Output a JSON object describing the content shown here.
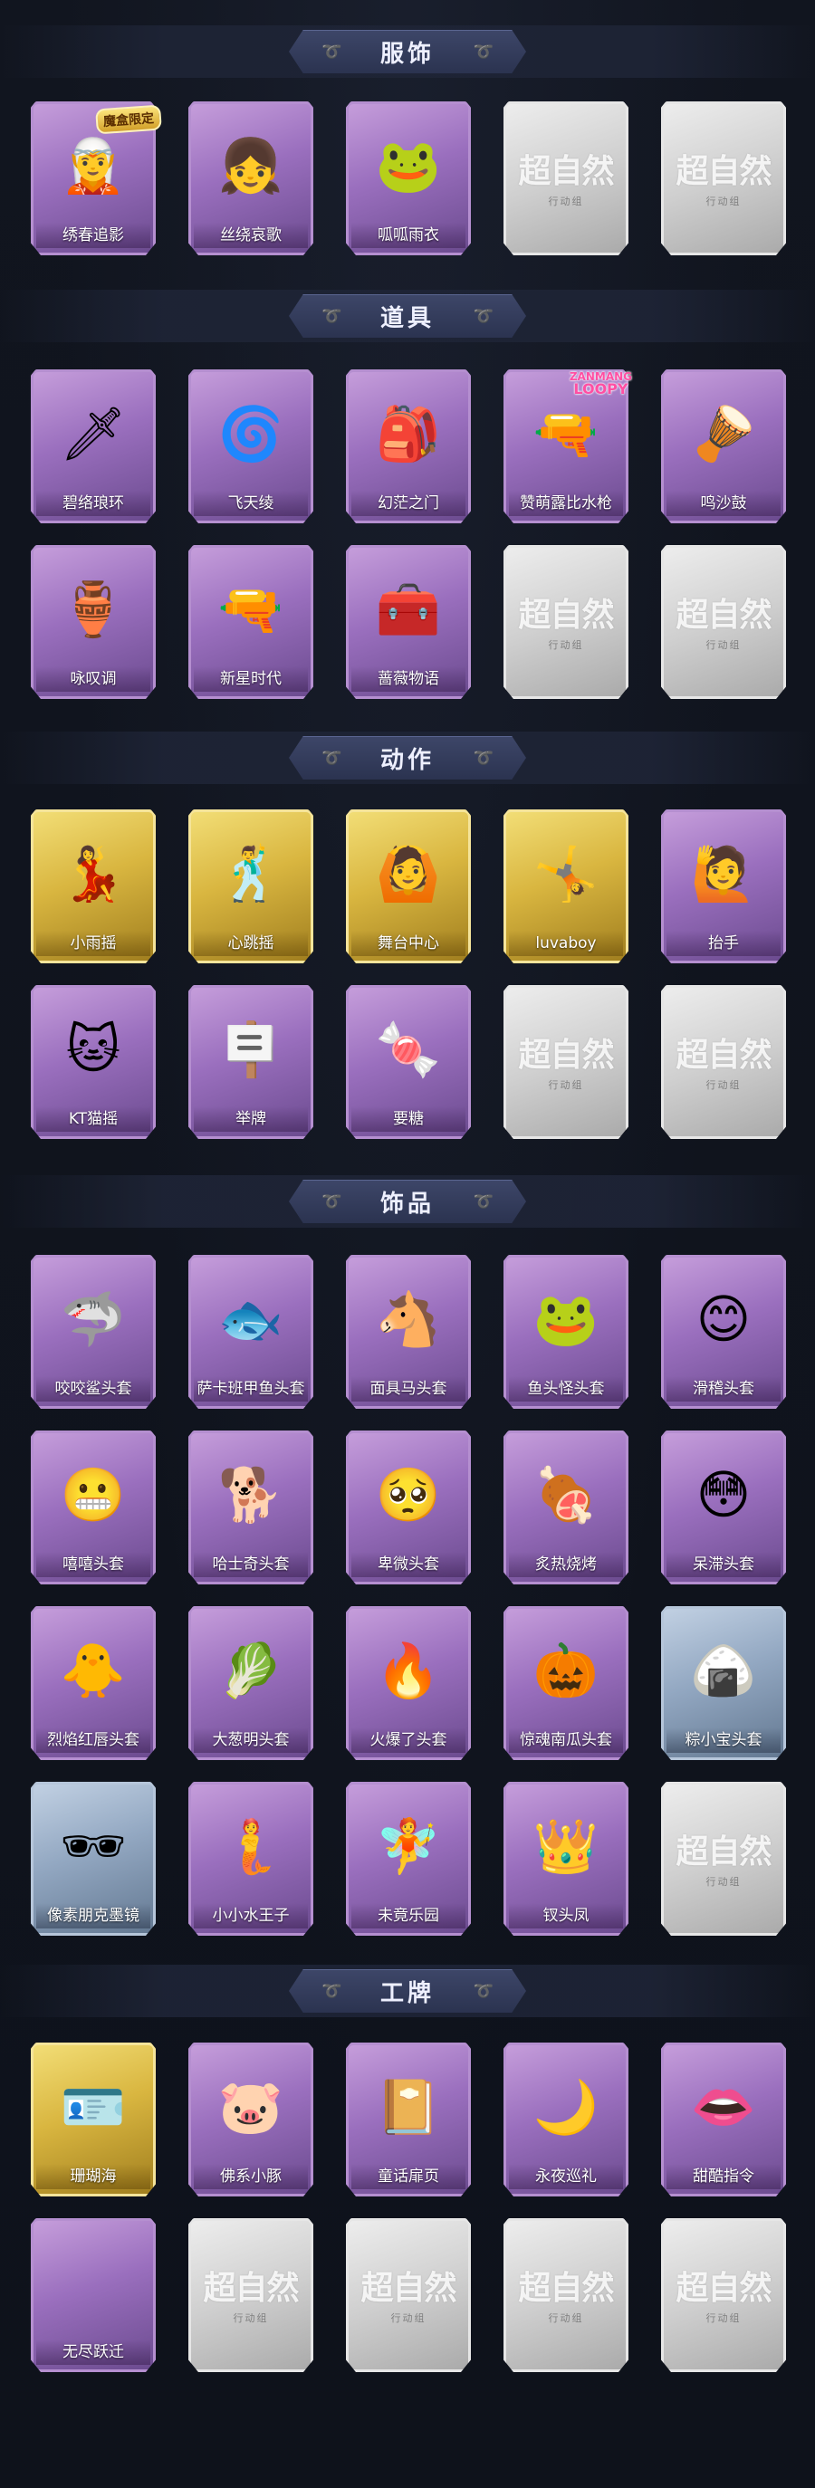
{
  "sections": [
    {
      "title": "服饰",
      "items": [
        {
          "label": "绣春追影",
          "tier": "purple",
          "icon": "long-hair-costume-character-icon",
          "glyph": "🧝",
          "badge": "魔盒限定"
        },
        {
          "label": "丝绕哀歌",
          "tier": "purple",
          "icon": "pink-hair-doll-character-icon",
          "glyph": "👧"
        },
        {
          "label": "呱呱雨衣",
          "tier": "purple",
          "icon": "frog-hood-raincoat-character-icon",
          "glyph": "🐸"
        },
        {
          "label": "",
          "tier": "empty",
          "icon": "empty-slot-icon"
        },
        {
          "label": "",
          "tier": "empty",
          "icon": "empty-slot-icon"
        }
      ]
    },
    {
      "title": "道具",
      "items": [
        {
          "label": "碧络琅环",
          "tier": "purple",
          "icon": "jade-sword-icon",
          "glyph": "🗡"
        },
        {
          "label": "飞天绫",
          "tier": "purple",
          "icon": "ribbon-whip-icon",
          "glyph": "🌀"
        },
        {
          "label": "幻茫之门",
          "tier": "purple",
          "icon": "pet-bag-door-icon",
          "glyph": "🎒"
        },
        {
          "label": "赞萌露比水枪",
          "tier": "purple",
          "icon": "water-gun-icon",
          "glyph": "🔫",
          "brand_top": "ZANMANG",
          "brand_bottom": "LOOPY"
        },
        {
          "label": "鸣沙鼓",
          "tier": "purple",
          "icon": "sand-drum-icon",
          "glyph": "🪘"
        },
        {
          "label": "咏叹调",
          "tier": "purple",
          "icon": "music-box-icon",
          "glyph": "🏺"
        },
        {
          "label": "新星时代",
          "tier": "purple",
          "icon": "golden-revolver-icon",
          "glyph": "🔫"
        },
        {
          "label": "蔷薇物语",
          "tier": "purple",
          "icon": "red-medical-kit-icon",
          "glyph": "🧰"
        },
        {
          "label": "",
          "tier": "empty",
          "icon": "empty-slot-icon"
        },
        {
          "label": "",
          "tier": "empty",
          "icon": "empty-slot-icon"
        }
      ]
    },
    {
      "title": "动作",
      "items": [
        {
          "label": "小雨摇",
          "tier": "gold",
          "icon": "dance-pose-icon",
          "glyph": "💃"
        },
        {
          "label": "心跳摇",
          "tier": "gold",
          "icon": "heart-dance-pose-icon",
          "glyph": "🕺"
        },
        {
          "label": "舞台中心",
          "tier": "gold",
          "icon": "stage-pose-icon",
          "glyph": "🙆"
        },
        {
          "label": "luvaboy",
          "tier": "gold",
          "icon": "luvaboy-pose-icon",
          "glyph": "🤸"
        },
        {
          "label": "抬手",
          "tier": "purple",
          "icon": "raise-hand-pose-icon",
          "glyph": "🙋"
        },
        {
          "label": "KT猫摇",
          "tier": "purple",
          "icon": "cat-dance-pose-icon",
          "glyph": "🐱"
        },
        {
          "label": "举牌",
          "tier": "purple",
          "icon": "hold-sign-pose-icon",
          "glyph": "🪧"
        },
        {
          "label": "要糖",
          "tier": "purple",
          "icon": "ask-candy-pose-icon",
          "glyph": "🍬"
        },
        {
          "label": "",
          "tier": "empty",
          "icon": "empty-slot-icon"
        },
        {
          "label": "",
          "tier": "empty",
          "icon": "empty-slot-icon"
        }
      ]
    },
    {
      "title": "饰品",
      "items": [
        {
          "label": "咬咬鲨头套",
          "tier": "purple",
          "icon": "shark-head-icon",
          "glyph": "🦈"
        },
        {
          "label": "萨卡班甲鱼头套",
          "tier": "purple",
          "icon": "fish-head-icon",
          "glyph": "🐟"
        },
        {
          "label": "面具马头套",
          "tier": "purple",
          "icon": "horse-head-icon",
          "glyph": "🐴"
        },
        {
          "label": "鱼头怪头套",
          "tier": "purple",
          "icon": "fish-monster-head-icon",
          "glyph": "🐸"
        },
        {
          "label": "滑稽头套",
          "tier": "purple",
          "icon": "funny-face-head-icon",
          "glyph": "😊"
        },
        {
          "label": "嘻嘻头套",
          "tier": "purple",
          "icon": "grin-face-head-icon",
          "glyph": "😬"
        },
        {
          "label": "哈士奇头套",
          "tier": "purple",
          "icon": "husky-head-icon",
          "glyph": "🐕"
        },
        {
          "label": "卑微头套",
          "tier": "purple",
          "icon": "humble-face-head-icon",
          "glyph": "🥺"
        },
        {
          "label": "炙热烧烤",
          "tier": "purple",
          "icon": "bbq-meat-head-icon",
          "glyph": "🍖"
        },
        {
          "label": "呆滞头套",
          "tier": "purple",
          "icon": "dazed-face-head-icon",
          "glyph": "😳"
        },
        {
          "label": "烈焰红唇头套",
          "tier": "purple",
          "icon": "red-lips-duck-head-icon",
          "glyph": "🐥"
        },
        {
          "label": "大葱明头套",
          "tier": "purple",
          "icon": "green-onion-head-icon",
          "glyph": "🥬"
        },
        {
          "label": "火爆了头套",
          "tier": "purple",
          "icon": "fire-sprite-head-icon",
          "glyph": "🔥"
        },
        {
          "label": "惊魂南瓜头套",
          "tier": "purple",
          "icon": "pumpkin-head-icon",
          "glyph": "🎃"
        },
        {
          "label": "粽小宝头套",
          "tier": "blue",
          "icon": "zongzi-head-icon",
          "glyph": "🍙"
        },
        {
          "label": "像素朋克墨镜",
          "tier": "blue",
          "icon": "pixel-sunglasses-icon",
          "glyph": "🕶"
        },
        {
          "label": "小小水王子",
          "tier": "purple",
          "icon": "water-prince-figure-icon",
          "glyph": "🧜"
        },
        {
          "label": "未竟乐园",
          "tier": "purple",
          "icon": "paradise-figure-icon",
          "glyph": "🧚"
        },
        {
          "label": "钗头凤",
          "tier": "purple",
          "icon": "phoenix-crown-figure-icon",
          "glyph": "👑"
        },
        {
          "label": "",
          "tier": "empty",
          "icon": "empty-slot-icon"
        }
      ]
    },
    {
      "title": "工牌",
      "items": [
        {
          "label": "珊瑚海",
          "tier": "gold",
          "icon": "coral-sea-card-icon",
          "glyph": "🪪"
        },
        {
          "label": "佛系小豚",
          "tier": "purple",
          "icon": "piggy-card-icon",
          "glyph": "🐷"
        },
        {
          "label": "童话扉页",
          "tier": "purple",
          "icon": "fairy-page-card-icon",
          "glyph": "📔"
        },
        {
          "label": "永夜巡礼",
          "tier": "purple",
          "icon": "eternal-night-card-icon",
          "glyph": "🌙"
        },
        {
          "label": "甜酷指令",
          "tier": "purple",
          "icon": "sweet-cool-card-icon",
          "glyph": "👄"
        },
        {
          "label": "无尽跃迁",
          "tier": "purple",
          "icon": "endless-warp-card-icon",
          "glyph": ""
        },
        {
          "label": "",
          "tier": "empty",
          "icon": "empty-slot-icon"
        },
        {
          "label": "",
          "tier": "empty",
          "icon": "empty-slot-icon"
        },
        {
          "label": "",
          "tier": "empty",
          "icon": "empty-slot-icon"
        },
        {
          "label": "",
          "tier": "empty",
          "icon": "empty-slot-icon"
        }
      ]
    }
  ],
  "placeholder": {
    "big": "超自然",
    "small": "行动组"
  },
  "colors": {
    "background": "#10141f",
    "header_plate": "#343d5c",
    "tier_purple": "#9a6fbe",
    "tier_gold": "#d9b640",
    "tier_blue": "#93a8c2",
    "tier_empty": "#cfcfcf"
  }
}
